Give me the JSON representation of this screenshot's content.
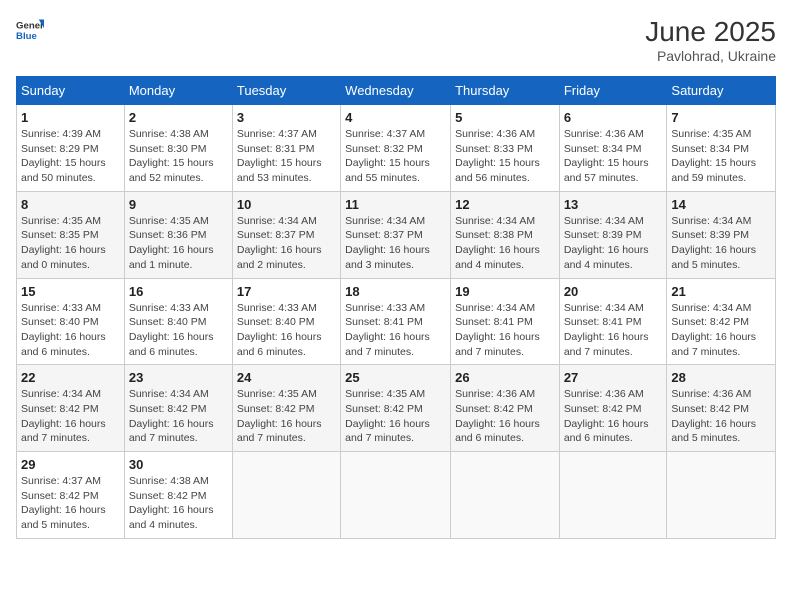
{
  "logo": {
    "general": "General",
    "blue": "Blue"
  },
  "title": "June 2025",
  "location": "Pavlohrad, Ukraine",
  "headers": [
    "Sunday",
    "Monday",
    "Tuesday",
    "Wednesday",
    "Thursday",
    "Friday",
    "Saturday"
  ],
  "weeks": [
    [
      {
        "day": "1",
        "sunrise": "4:39 AM",
        "sunset": "8:29 PM",
        "daylight": "15 hours and 50 minutes."
      },
      {
        "day": "2",
        "sunrise": "4:38 AM",
        "sunset": "8:30 PM",
        "daylight": "15 hours and 52 minutes."
      },
      {
        "day": "3",
        "sunrise": "4:37 AM",
        "sunset": "8:31 PM",
        "daylight": "15 hours and 53 minutes."
      },
      {
        "day": "4",
        "sunrise": "4:37 AM",
        "sunset": "8:32 PM",
        "daylight": "15 hours and 55 minutes."
      },
      {
        "day": "5",
        "sunrise": "4:36 AM",
        "sunset": "8:33 PM",
        "daylight": "15 hours and 56 minutes."
      },
      {
        "day": "6",
        "sunrise": "4:36 AM",
        "sunset": "8:34 PM",
        "daylight": "15 hours and 57 minutes."
      },
      {
        "day": "7",
        "sunrise": "4:35 AM",
        "sunset": "8:34 PM",
        "daylight": "15 hours and 59 minutes."
      }
    ],
    [
      {
        "day": "8",
        "sunrise": "4:35 AM",
        "sunset": "8:35 PM",
        "daylight": "16 hours and 0 minutes."
      },
      {
        "day": "9",
        "sunrise": "4:35 AM",
        "sunset": "8:36 PM",
        "daylight": "16 hours and 1 minute."
      },
      {
        "day": "10",
        "sunrise": "4:34 AM",
        "sunset": "8:37 PM",
        "daylight": "16 hours and 2 minutes."
      },
      {
        "day": "11",
        "sunrise": "4:34 AM",
        "sunset": "8:37 PM",
        "daylight": "16 hours and 3 minutes."
      },
      {
        "day": "12",
        "sunrise": "4:34 AM",
        "sunset": "8:38 PM",
        "daylight": "16 hours and 4 minutes."
      },
      {
        "day": "13",
        "sunrise": "4:34 AM",
        "sunset": "8:39 PM",
        "daylight": "16 hours and 4 minutes."
      },
      {
        "day": "14",
        "sunrise": "4:34 AM",
        "sunset": "8:39 PM",
        "daylight": "16 hours and 5 minutes."
      }
    ],
    [
      {
        "day": "15",
        "sunrise": "4:33 AM",
        "sunset": "8:40 PM",
        "daylight": "16 hours and 6 minutes."
      },
      {
        "day": "16",
        "sunrise": "4:33 AM",
        "sunset": "8:40 PM",
        "daylight": "16 hours and 6 minutes."
      },
      {
        "day": "17",
        "sunrise": "4:33 AM",
        "sunset": "8:40 PM",
        "daylight": "16 hours and 6 minutes."
      },
      {
        "day": "18",
        "sunrise": "4:33 AM",
        "sunset": "8:41 PM",
        "daylight": "16 hours and 7 minutes."
      },
      {
        "day": "19",
        "sunrise": "4:34 AM",
        "sunset": "8:41 PM",
        "daylight": "16 hours and 7 minutes."
      },
      {
        "day": "20",
        "sunrise": "4:34 AM",
        "sunset": "8:41 PM",
        "daylight": "16 hours and 7 minutes."
      },
      {
        "day": "21",
        "sunrise": "4:34 AM",
        "sunset": "8:42 PM",
        "daylight": "16 hours and 7 minutes."
      }
    ],
    [
      {
        "day": "22",
        "sunrise": "4:34 AM",
        "sunset": "8:42 PM",
        "daylight": "16 hours and 7 minutes."
      },
      {
        "day": "23",
        "sunrise": "4:34 AM",
        "sunset": "8:42 PM",
        "daylight": "16 hours and 7 minutes."
      },
      {
        "day": "24",
        "sunrise": "4:35 AM",
        "sunset": "8:42 PM",
        "daylight": "16 hours and 7 minutes."
      },
      {
        "day": "25",
        "sunrise": "4:35 AM",
        "sunset": "8:42 PM",
        "daylight": "16 hours and 7 minutes."
      },
      {
        "day": "26",
        "sunrise": "4:36 AM",
        "sunset": "8:42 PM",
        "daylight": "16 hours and 6 minutes."
      },
      {
        "day": "27",
        "sunrise": "4:36 AM",
        "sunset": "8:42 PM",
        "daylight": "16 hours and 6 minutes."
      },
      {
        "day": "28",
        "sunrise": "4:36 AM",
        "sunset": "8:42 PM",
        "daylight": "16 hours and 5 minutes."
      }
    ],
    [
      {
        "day": "29",
        "sunrise": "4:37 AM",
        "sunset": "8:42 PM",
        "daylight": "16 hours and 5 minutes."
      },
      {
        "day": "30",
        "sunrise": "4:38 AM",
        "sunset": "8:42 PM",
        "daylight": "16 hours and 4 minutes."
      },
      null,
      null,
      null,
      null,
      null
    ]
  ]
}
